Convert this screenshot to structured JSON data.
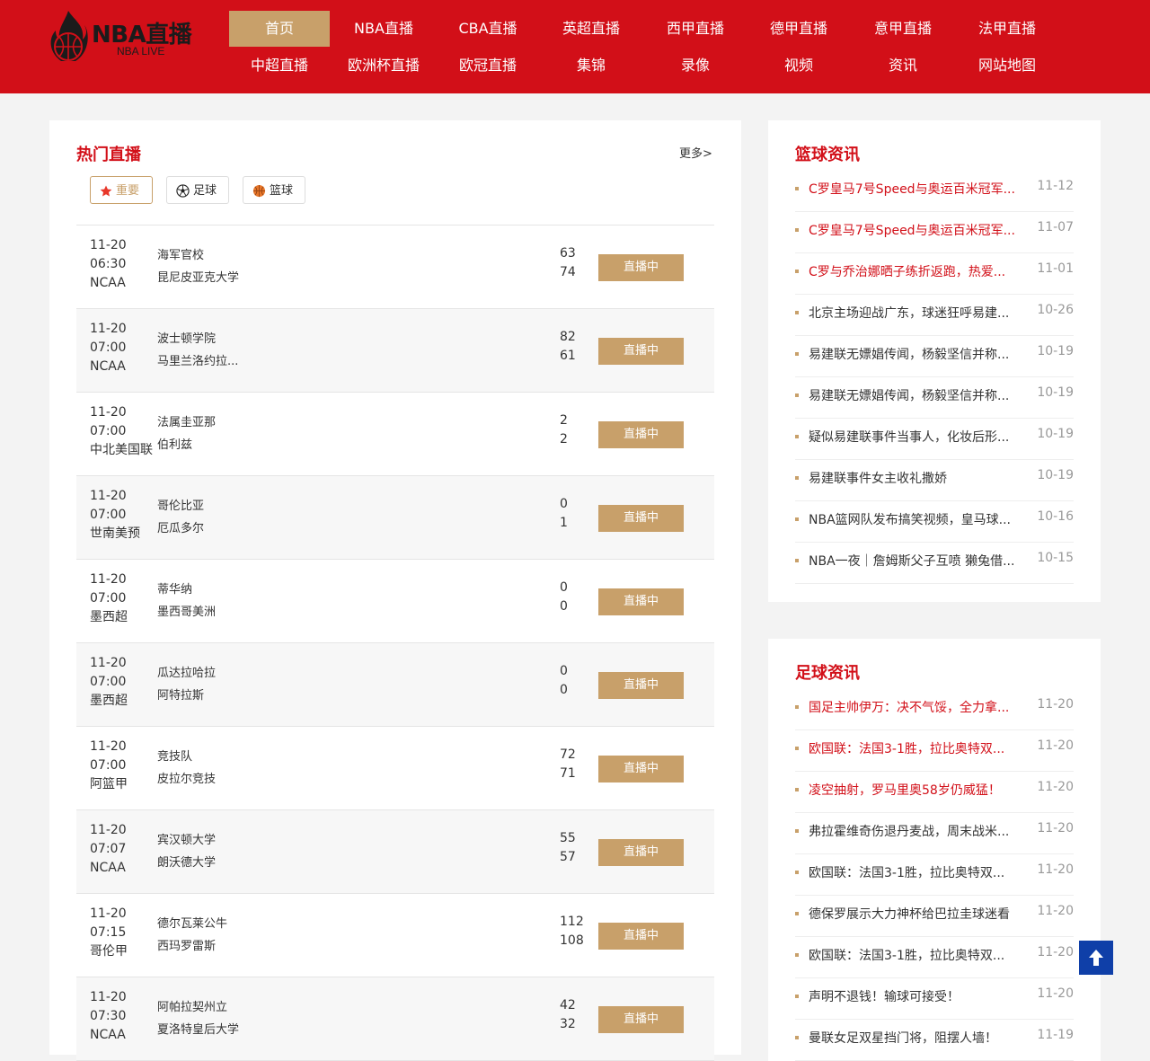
{
  "logo": {
    "main": "NBA直播",
    "sub": "NBA LIVE"
  },
  "nav": [
    {
      "label": "首页",
      "active": true
    },
    {
      "label": "NBA直播"
    },
    {
      "label": "CBA直播"
    },
    {
      "label": "英超直播"
    },
    {
      "label": "西甲直播"
    },
    {
      "label": "德甲直播"
    },
    {
      "label": "意甲直播"
    },
    {
      "label": "法甲直播"
    },
    {
      "label": "中超直播"
    },
    {
      "label": "欧洲杯直播"
    },
    {
      "label": "欧冠直播"
    },
    {
      "label": "集锦"
    },
    {
      "label": "录像"
    },
    {
      "label": "视频"
    },
    {
      "label": "资讯"
    },
    {
      "label": "网站地图"
    }
  ],
  "hot": {
    "title": "热门直播",
    "more": "更多>",
    "filters": [
      {
        "label": "重要",
        "icon": "star-icon",
        "active": true
      },
      {
        "label": "足球",
        "icon": "soccer-ball-icon"
      },
      {
        "label": "篮球",
        "icon": "basketball-icon"
      }
    ],
    "live_label": "直播中",
    "matches": [
      {
        "date": "11-20",
        "time": "06:30",
        "league": "NCAA",
        "home": "海军官校",
        "away": "昆尼皮亚克大学",
        "s1": "63",
        "s2": "74"
      },
      {
        "date": "11-20",
        "time": "07:00",
        "league": "NCAA",
        "home": "波士顿学院",
        "away": "马里兰洛约拉...",
        "s1": "82",
        "s2": "61"
      },
      {
        "date": "11-20",
        "time": "07:00",
        "league": "中北美国联",
        "home": "法属圭亚那",
        "away": "伯利兹",
        "s1": "2",
        "s2": "2"
      },
      {
        "date": "11-20",
        "time": "07:00",
        "league": "世南美预",
        "home": "哥伦比亚",
        "away": "厄瓜多尔",
        "s1": "0",
        "s2": "1"
      },
      {
        "date": "11-20",
        "time": "07:00",
        "league": "墨西超",
        "home": "蒂华纳",
        "away": "墨西哥美洲",
        "s1": "0",
        "s2": "0"
      },
      {
        "date": "11-20",
        "time": "07:00",
        "league": "墨西超",
        "home": "瓜达拉哈拉",
        "away": "阿特拉斯",
        "s1": "0",
        "s2": "0"
      },
      {
        "date": "11-20",
        "time": "07:00",
        "league": "阿篮甲",
        "home": "竞技队",
        "away": "皮拉尔竞技",
        "s1": "72",
        "s2": "71"
      },
      {
        "date": "11-20",
        "time": "07:07",
        "league": "NCAA",
        "home": "宾汉顿大学",
        "away": "朗沃德大学",
        "s1": "55",
        "s2": "57"
      },
      {
        "date": "11-20",
        "time": "07:15",
        "league": "哥伦甲",
        "home": "德尔瓦莱公牛",
        "away": "西玛罗雷斯",
        "s1": "112",
        "s2": "108"
      },
      {
        "date": "11-20",
        "time": "07:30",
        "league": "NCAA",
        "home": "阿帕拉契州立",
        "away": "夏洛特皇后大学",
        "s1": "42",
        "s2": "32"
      }
    ]
  },
  "basketball_news": {
    "title": "篮球资讯",
    "items": [
      {
        "title": "C罗皇马7号Speed与奥运百米冠军...",
        "date": "11-12",
        "hot": true
      },
      {
        "title": "C罗皇马7号Speed与奥运百米冠军...",
        "date": "11-07",
        "hot": true
      },
      {
        "title": "C罗与乔治娜晒子练折返跑，热爱...",
        "date": "11-01",
        "hot": true
      },
      {
        "title": "北京主场迎战广东，球迷狂呼易建...",
        "date": "10-26"
      },
      {
        "title": "易建联无嫖娼传闻，杨毅坚信并称...",
        "date": "10-19"
      },
      {
        "title": "易建联无嫖娼传闻，杨毅坚信并称...",
        "date": "10-19"
      },
      {
        "title": "疑似易建联事件当事人，化妆后形...",
        "date": "10-19"
      },
      {
        "title": "易建联事件女主收礼撒娇",
        "date": "10-19"
      },
      {
        "title": "NBA篮网队发布搞笑视频，皇马球...",
        "date": "10-16"
      },
      {
        "title": "NBA一夜｜詹姆斯父子互喷 獭兔借...",
        "date": "10-15"
      }
    ]
  },
  "football_news": {
    "title": "足球资讯",
    "items": [
      {
        "title": "国足主帅伊万：决不气馁，全力拿...",
        "date": "11-20",
        "hot": true
      },
      {
        "title": "欧国联：法国3-1胜，拉比奥特双...",
        "date": "11-20",
        "hot": true
      },
      {
        "title": "凌空抽射，罗马里奥58岁仍威猛！",
        "date": "11-20",
        "hot": true
      },
      {
        "title": "弗拉霍维奇伤退丹麦战，周末战米...",
        "date": "11-20"
      },
      {
        "title": "欧国联：法国3-1胜，拉比奥特双...",
        "date": "11-20"
      },
      {
        "title": "德保罗展示大力神杯给巴拉圭球迷看",
        "date": "11-20"
      },
      {
        "title": "欧国联：法国3-1胜，拉比奥特双...",
        "date": "11-20"
      },
      {
        "title": "声明不退钱！输球可接受！",
        "date": "11-20"
      },
      {
        "title": "曼联女足双星挡门将，阻摆人墙！",
        "date": "11-19"
      }
    ]
  },
  "colors": {
    "brand_red": "#d20f18",
    "gold": "#c8a06a",
    "back_top_blue": "#0f3fa8"
  }
}
